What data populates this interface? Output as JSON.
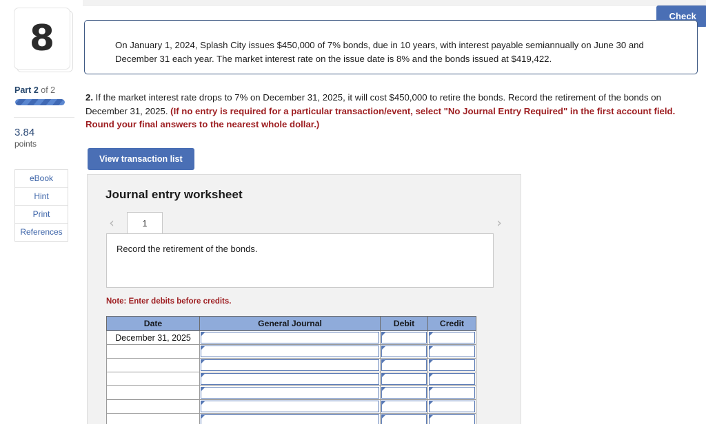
{
  "topbar": {
    "check_label": "Check"
  },
  "sidebar": {
    "question_number": "8",
    "part_prefix": "Part",
    "part_current": "2",
    "part_suffix": "of 2",
    "progress_percent": 100,
    "points_value": "3.84",
    "points_label": "points",
    "links": [
      {
        "label": "eBook"
      },
      {
        "label": "Hint"
      },
      {
        "label": "Print"
      },
      {
        "label": "References"
      }
    ]
  },
  "main": {
    "problem_statement": "On January 1, 2024, Splash City issues $450,000 of 7% bonds, due in 10 years, with interest payable semiannually on June 30 and December 31 each year. The market interest rate on the issue date is 8% and the bonds issued at $419,422.",
    "requirement": {
      "number": "2.",
      "text": " If the market interest rate drops to 7% on December 31, 2025, it will cost $450,000 to retire the bonds. Record the retirement of the bonds on December 31, 2025. ",
      "emphasis": "(If no entry is required for a particular transaction/event, select \"No Journal Entry Required\" in the first account field. Round your final answers to the nearest whole dollar.)"
    },
    "view_transaction_list_label": "View transaction list"
  },
  "worksheet": {
    "title": "Journal entry worksheet",
    "prev_arrow": "‹",
    "next_arrow": "›",
    "tabs": [
      {
        "label": "1"
      }
    ],
    "active_tab": "1",
    "instruction": "Record the retirement of the bonds.",
    "note": "Note: Enter debits before credits.",
    "table": {
      "headers": [
        "Date",
        "General Journal",
        "Debit",
        "Credit"
      ],
      "rows": [
        {
          "date": "December 31, 2025",
          "general_journal": "",
          "debit": "",
          "credit": ""
        },
        {
          "date": "",
          "general_journal": "",
          "debit": "",
          "credit": ""
        },
        {
          "date": "",
          "general_journal": "",
          "debit": "",
          "credit": ""
        },
        {
          "date": "",
          "general_journal": "",
          "debit": "",
          "credit": ""
        },
        {
          "date": "",
          "general_journal": "",
          "debit": "",
          "credit": ""
        },
        {
          "date": "",
          "general_journal": "",
          "debit": "",
          "credit": ""
        },
        {
          "date": "",
          "general_journal": "",
          "debit": "",
          "credit": ""
        }
      ]
    }
  },
  "colors": {
    "accent_blue": "#4a6fb5",
    "header_blue": "#8fabda",
    "input_border": "#5778b4",
    "warning_red": "#9e1f22",
    "link_blue": "#3b63a8"
  }
}
